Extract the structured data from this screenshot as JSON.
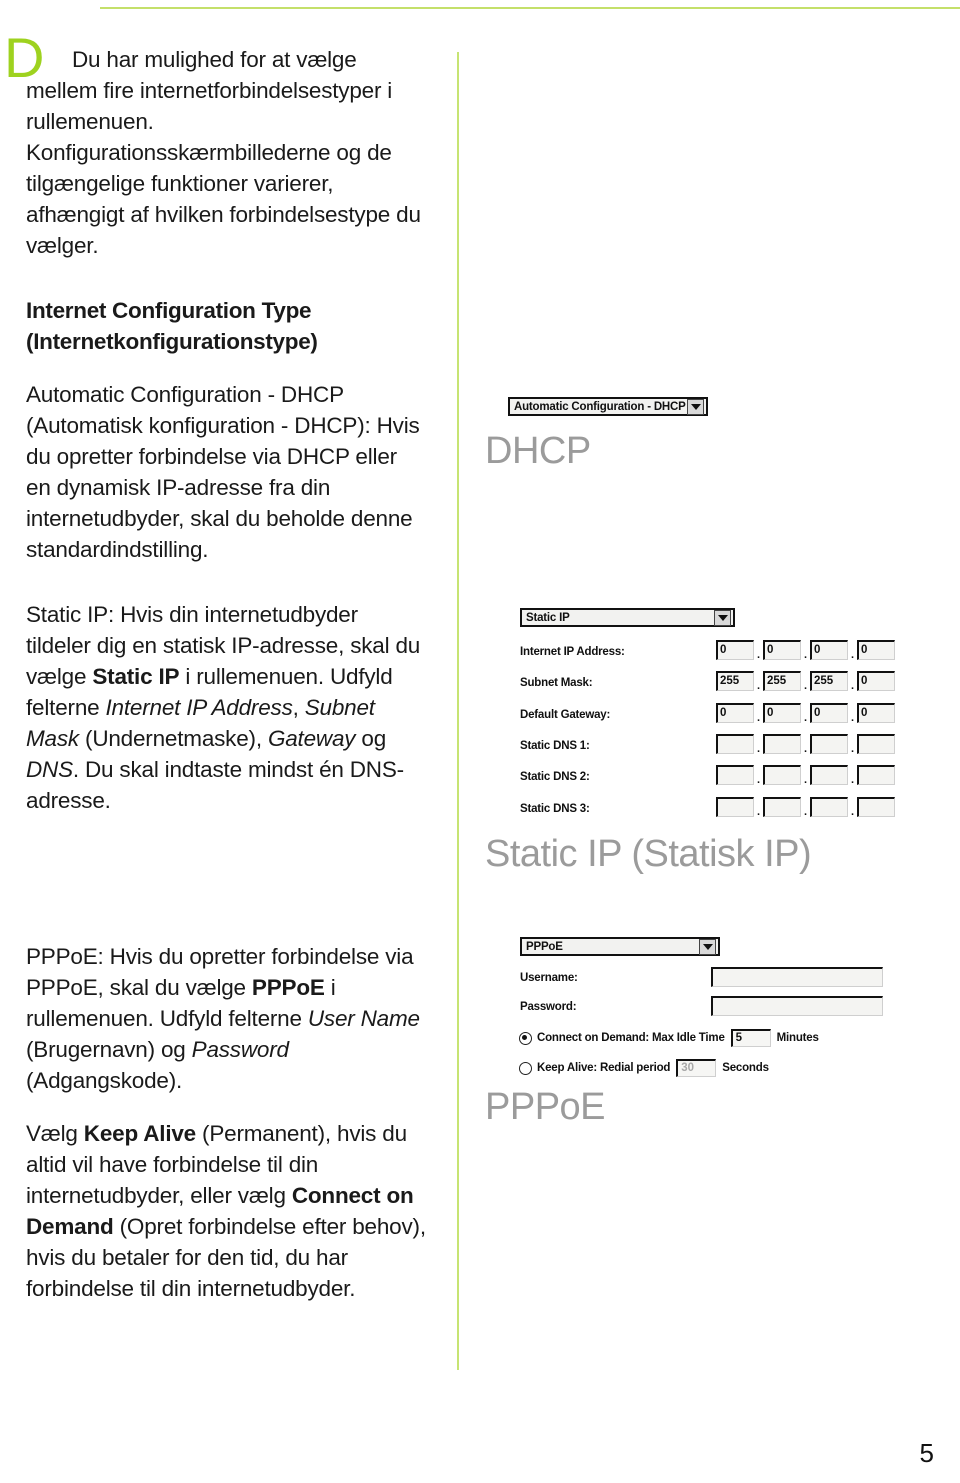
{
  "page": {
    "number": "5",
    "dropcap": "D",
    "accent_green": "#9ed21f",
    "rule_green": "#c7e473",
    "caption_gray": "#9b9b9b"
  },
  "left_column": {
    "intro": "Du har mulighed for at vælge mellem fire internetforbindelsestyper i rullemenuen. Konfigurationsskærmbillederne og de tilgængelige funktioner varierer, afhængigt af hvilken forbindelsestype du vælger.",
    "heading_line1": "Internet Configuration Type",
    "heading_line2": "(Internetkonfigurationstype)",
    "dhcp_paragraph": "Automatic Configuration - DHCP (Automatisk konfiguration - DHCP): Hvis du opretter forbindelse via DHCP eller en dynamisk IP-adresse fra din internetudbyder, skal du beholde denne standardindstilling.",
    "static_paragraph": {
      "p1": "Static IP: Hvis din internetudbyder tildeler dig en statisk IP-adresse, skal du vælge ",
      "bold1": "Static IP",
      "p2": " i rullemenuen. Udfyld felterne ",
      "italic1": "Internet IP Address",
      "p3": ", ",
      "italic2": "Subnet Mask",
      "p4": " (Undernetmaske), ",
      "italic3": "Gateway",
      "p5": " og ",
      "italic4": "DNS",
      "p6": ". Du skal indtaste mindst én DNS-adresse."
    },
    "pppoe_paragraph": {
      "p1": "PPPoE: Hvis du opretter forbindelse via PPPoE, skal du vælge ",
      "bold1": "PPPoE",
      "p2": " i rullemenuen. Udfyld felterne ",
      "italic1": "User Name",
      "p3": " (Brugernavn) og ",
      "italic2": "Password",
      "p4": " (Adgangskode)."
    },
    "keepalive_paragraph": {
      "p1": "Vælg ",
      "bold1": "Keep Alive",
      "p2": " (Permanent), hvis du altid vil have forbindelse til din internetudbyder, eller vælg ",
      "bold2": "Connect on Demand",
      "p3": " (Opret forbindelse efter behov), hvis du betaler for den tid, du har forbindelse til din internetudbyder."
    }
  },
  "right_column": {
    "dhcp": {
      "select_value": "Automatic Configuration - DHCP",
      "caption": "DHCP"
    },
    "static_ip": {
      "select_value": "Static IP",
      "caption": "Static IP (Statisk IP)",
      "rows": [
        {
          "label": "Internet IP Address:",
          "octets": [
            "0",
            "0",
            "0",
            "0"
          ]
        },
        {
          "label": "Subnet Mask:",
          "octets": [
            "255",
            "255",
            "255",
            "0"
          ]
        },
        {
          "label": "Default Gateway:",
          "octets": [
            "0",
            "0",
            "0",
            "0"
          ]
        },
        {
          "label": "Static DNS 1:",
          "octets": [
            "",
            "",
            "",
            ""
          ]
        },
        {
          "label": "Static DNS 2:",
          "octets": [
            "",
            "",
            "",
            ""
          ]
        },
        {
          "label": "Static DNS 3:",
          "octets": [
            "",
            "",
            "",
            ""
          ]
        }
      ]
    },
    "pppoe": {
      "select_value": "PPPoE",
      "caption": "PPPoE",
      "username_label": "Username:",
      "username_value": "",
      "password_label": "Password:",
      "password_value": "",
      "connect_on_demand": {
        "label_before": "Connect on Demand: Max Idle Time",
        "value": "5",
        "unit": "Minutes",
        "selected": true
      },
      "keep_alive": {
        "label_before": "Keep Alive: Redial period",
        "value": "30",
        "unit": "Seconds",
        "selected": false
      }
    }
  }
}
